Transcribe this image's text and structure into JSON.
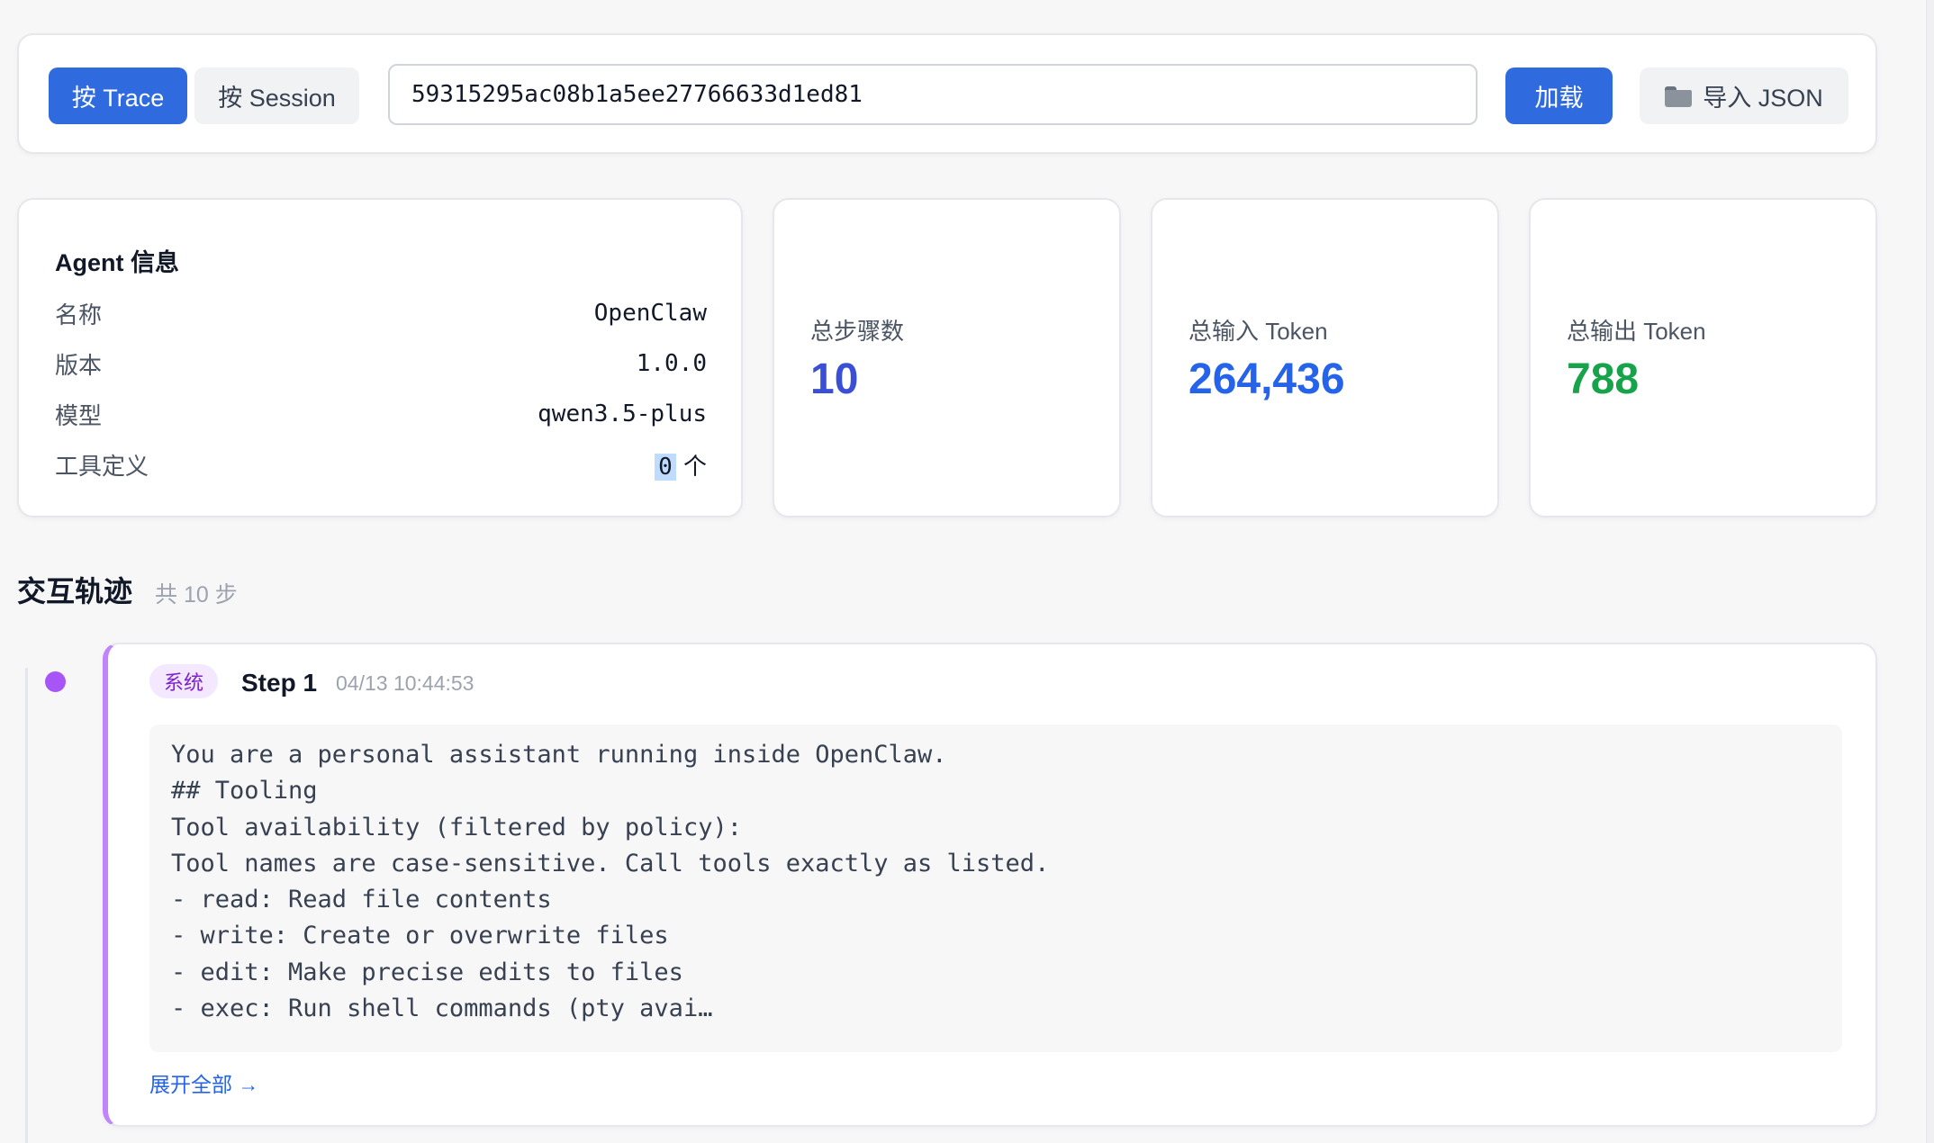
{
  "toolbar": {
    "tab_trace": "按 Trace",
    "tab_session": "按 Session",
    "trace_id": "59315295ac08b1a5ee27766633d1ed81",
    "load_label": "加载",
    "import_label": "导入 JSON",
    "import_icon": "folder-icon"
  },
  "agent": {
    "title": "Agent 信息",
    "rows": [
      {
        "key": "名称",
        "value": "OpenClaw"
      },
      {
        "key": "版本",
        "value": "1.0.0"
      },
      {
        "key": "模型",
        "value": "qwen3.5-plus"
      },
      {
        "key": "工具定义",
        "value": "0",
        "suffix": " 个"
      }
    ]
  },
  "stats": [
    {
      "label": "总步骤数",
      "value": "10",
      "color": "#3b4fd6"
    },
    {
      "label": "总输入 Token",
      "value": "264,436",
      "color": "#2563eb"
    },
    {
      "label": "总输出 Token",
      "value": "788",
      "color": "#16a34a"
    }
  ],
  "timeline": {
    "title": "交互轨迹",
    "count": "共 10 步",
    "accent_color": "#a855f7",
    "steps": [
      {
        "role": "系统",
        "label": "Step 1",
        "time": "04/13 10:44:53",
        "lines": [
          "You are a personal assistant running inside OpenClaw.",
          "## Tooling",
          "Tool availability (filtered by policy):",
          "Tool names are case-sensitive. Call tools exactly as listed.",
          "- read: Read file contents",
          "- write: Create or overwrite files",
          "- edit: Make precise edits to files",
          "- exec: Run shell commands (pty avai…"
        ],
        "expand_label": "展开全部 →"
      }
    ]
  }
}
